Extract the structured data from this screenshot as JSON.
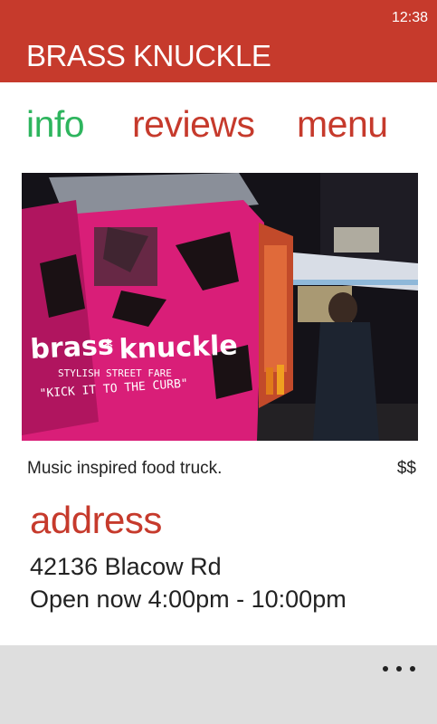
{
  "status_bar": {
    "time": "12:38"
  },
  "header": {
    "title": "BRASS KNUCKLE"
  },
  "tabs": [
    {
      "label": "info",
      "active": true
    },
    {
      "label": "reviews",
      "active": false
    },
    {
      "label": "menu",
      "active": false
    }
  ],
  "photo": {
    "sign_brand": "brass * knuckle",
    "sign_tagline": "STYLISH STREET FARE",
    "sign_slogan": "\"KICK IT TO THE CURB\""
  },
  "details": {
    "description": "Music inspired food truck.",
    "price": "$$"
  },
  "address_section": {
    "heading": "address",
    "street": "42136 Blacow Rd",
    "hours": "Open now 4:00pm - 10:00pm"
  },
  "app_bar": {
    "more_icon": "ellipsis-icon"
  },
  "colors": {
    "accent": "#c63a2c",
    "active_tab": "#2eb55e",
    "app_bar_bg": "#dedede"
  }
}
